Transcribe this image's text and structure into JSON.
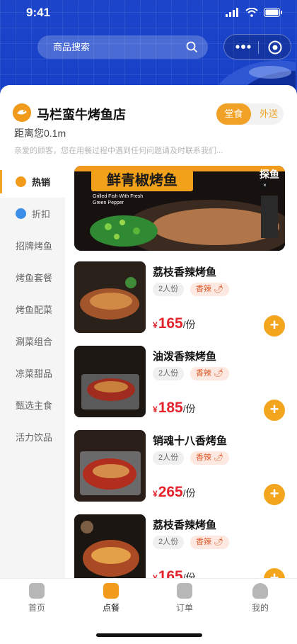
{
  "status_bar": {
    "time": "9:41"
  },
  "search": {
    "placeholder": "商品搜索"
  },
  "store": {
    "name": "马栏蛮牛烤鱼店",
    "distance": "距离您0.1m",
    "notice": "亲爱的顾客，您在用餐过程中遇到任何问题请及时联系我们...",
    "modes": [
      "堂食",
      "外送"
    ],
    "active_mode": "堂食"
  },
  "categories": [
    {
      "label": "热销",
      "active": true
    },
    {
      "label": "折扣"
    },
    {
      "label": "招牌烤鱼"
    },
    {
      "label": "烤鱼套餐"
    },
    {
      "label": "烤鱼配菜"
    },
    {
      "label": "涮菜组合"
    },
    {
      "label": "凉菜甜品"
    },
    {
      "label": "甄选主食"
    },
    {
      "label": "活力饮品"
    }
  ],
  "banner": {
    "title": "鲜青椒烤鱼",
    "subtitle": "Grilled Fish With Fresh Green Pepper",
    "brand": "探鱼"
  },
  "products": [
    {
      "name": "荔枝香辣烤鱼",
      "serving": "2人份",
      "flavor": "香辣",
      "currency": "¥",
      "price": "165",
      "unit": "/份"
    },
    {
      "name": "油泼香辣烤鱼",
      "serving": "2人份",
      "flavor": "香辣",
      "currency": "¥",
      "price": "185",
      "unit": "/份"
    },
    {
      "name": "销魂十八香烤鱼",
      "serving": "2人份",
      "flavor": "香辣",
      "currency": "¥",
      "price": "265",
      "unit": "/份"
    },
    {
      "name": "荔枝香辣烤鱼",
      "serving": "2人份",
      "flavor": "香辣",
      "currency": "¥",
      "price": "165",
      "unit": "/份"
    }
  ],
  "tabs": [
    {
      "label": "首页"
    },
    {
      "label": "点餐",
      "active": true
    },
    {
      "label": "订单"
    },
    {
      "label": "我的"
    }
  ],
  "colors": {
    "brand_orange": "#f1a126",
    "price_red": "#e4232d",
    "header_blue": "#1640c8"
  },
  "icons": {
    "search": "search-icon",
    "more": "more-icon",
    "capsule_target": "target-icon",
    "add": "plus-icon"
  }
}
